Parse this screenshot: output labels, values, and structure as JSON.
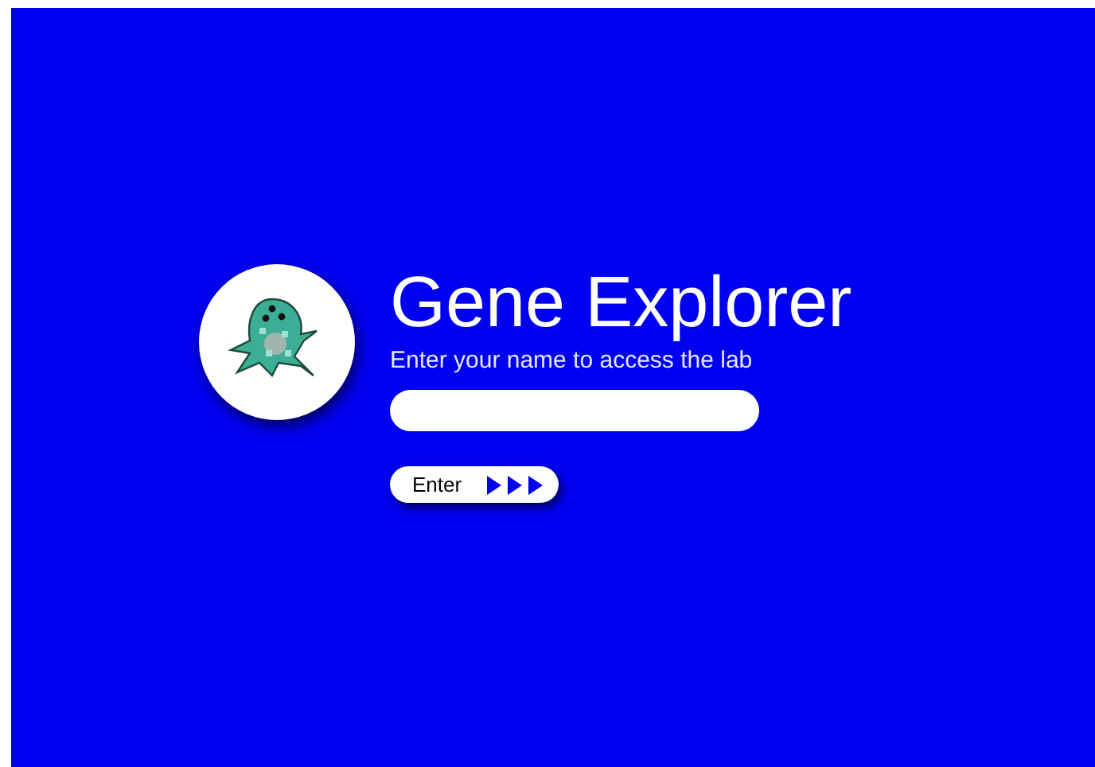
{
  "title": "Gene Explorer",
  "subtitle": "Enter your name to access the lab",
  "enter_button": {
    "label": "Enter"
  }
}
